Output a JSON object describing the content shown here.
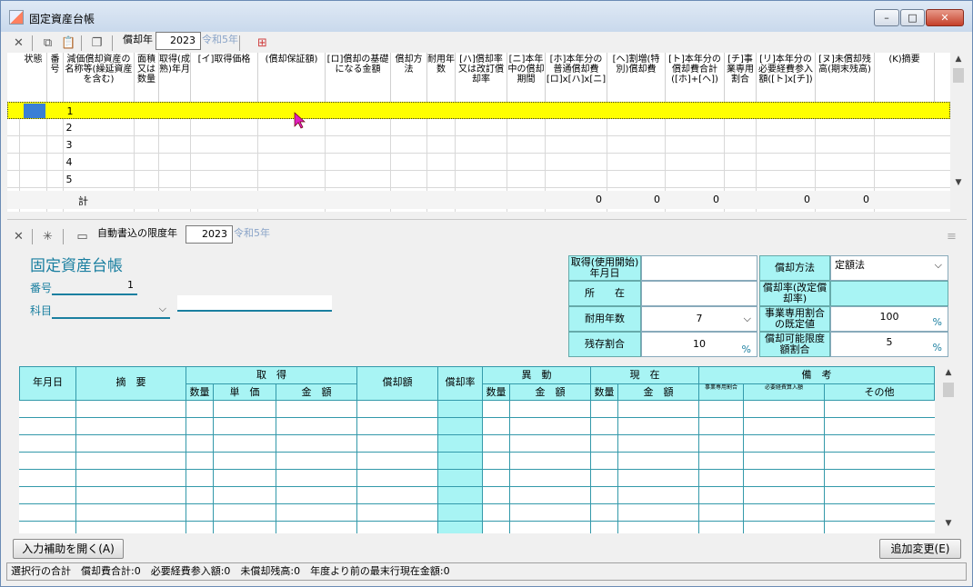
{
  "window": {
    "title": "固定資産台帳"
  },
  "top_toolbar": {
    "year_label": "償却年",
    "year_value": "2023",
    "era": "令和5年"
  },
  "main_grid": {
    "headers": [
      {
        "id": "status",
        "label": "状態"
      },
      {
        "id": "number",
        "label": "番号"
      },
      {
        "id": "name",
        "label": "減価償却資産の名称等(繰延資産を含む)"
      },
      {
        "id": "qty",
        "label": "面積又は数量"
      },
      {
        "id": "acq_date",
        "label": "取得(成熟)年月"
      },
      {
        "id": "acq_price",
        "label": "[イ]取得価格"
      },
      {
        "id": "guarantee",
        "label": "(償却保証額)"
      },
      {
        "id": "base",
        "label": "[ロ]償却の基礎になる金額"
      },
      {
        "id": "method",
        "label": "償却方法"
      },
      {
        "id": "life",
        "label": "耐用年数"
      },
      {
        "id": "rate",
        "label": "[ハ]償却率又は改訂償却率"
      },
      {
        "id": "months",
        "label": "[ニ]本年中の償却期間"
      },
      {
        "id": "normal",
        "label": "[ホ]本年分の普通償却費[ロ]x[ハ]x[ニ]"
      },
      {
        "id": "special",
        "label": "[ヘ]割増(特別)償却費"
      },
      {
        "id": "total",
        "label": "[ト]本年分の償却費合計([ホ]+[ヘ])"
      },
      {
        "id": "biz_ratio",
        "label": "[チ]事業専用割合"
      },
      {
        "id": "expense",
        "label": "[リ]本年分の必要経費参入額([ト]x[チ])"
      },
      {
        "id": "remain",
        "label": "[ヌ]未償却残高(期末残高)"
      },
      {
        "id": "memo",
        "label": "(K)摘要"
      }
    ],
    "rows": [
      "1",
      "2",
      "3",
      "4",
      "5"
    ],
    "sum_label": "計",
    "sums": {
      "normal": "0",
      "special": "0",
      "total": "0",
      "expense": "0",
      "remain": "0"
    }
  },
  "detail_toolbar": {
    "year_label": "自動書込の限度年",
    "year_value": "2023",
    "era": "令和5年"
  },
  "detail": {
    "title": "固定資産台帳",
    "number_label": "番号",
    "number_value": "1",
    "subject_label": "科目"
  },
  "form": {
    "acq_date_label": "取得(使用開始)年月日",
    "location_label": "所　　在",
    "life_label": "耐用年数",
    "life_value": "7",
    "residual_label": "残存割合",
    "residual_value": "10",
    "method_label": "償却方法",
    "method_value": "定額法",
    "rate_label": "償却率(改定償却率)",
    "biz_label": "事業専用割合の既定値",
    "biz_value": "100",
    "limit_label": "償却可能限度額割合",
    "limit_value": "5",
    "pct": "%"
  },
  "ledger": {
    "h_date": "年月日",
    "h_summary": "摘　要",
    "h_acq": "取　得",
    "h_dep": "償却額",
    "h_rate": "償却率",
    "h_move": "異　動",
    "h_now": "現　在",
    "h_remark": "備　考",
    "h_qty": "数量",
    "h_unit": "単　価",
    "h_amount": "金　額",
    "h_biz": "事業専用割合",
    "h_expense": "必要経費算入額",
    "h_other": "その他"
  },
  "buttons": {
    "assist": "入力補助を開く(A)",
    "add": "追加変更(E)"
  },
  "status": {
    "text": "選択行の合計　償却費合計:0　必要経費参入額:0　未償却残高:0　年度より前の最末行現在金額:0"
  }
}
